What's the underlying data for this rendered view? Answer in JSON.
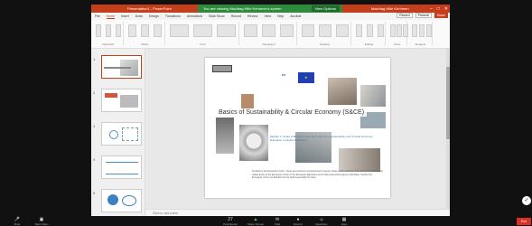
{
  "share_bar": {
    "text": "You are viewing Machtag Hille Kerhmen's screen",
    "options_label": "View Options"
  },
  "ppt": {
    "window_title": "Presentation1 - PowerPoint",
    "user": "Machtag Hille Kerhmen",
    "menu": [
      "File",
      "Home",
      "Insert",
      "Draw",
      "Design",
      "Transitions",
      "Animations",
      "Slide Show",
      "Record",
      "Review",
      "View",
      "Help",
      "Acrobat"
    ],
    "menu_right": {
      "record": "Record",
      "present": "Present",
      "share": "Share"
    },
    "ribbon_groups": [
      "Clipboard",
      "Slides",
      "Font",
      "Paragraph",
      "Drawing",
      "Editing",
      "Voice",
      "Designer"
    ],
    "notes_placeholder": "Click to add notes",
    "slide_numbers": [
      "1",
      "2",
      "3",
      "4",
      "5"
    ]
  },
  "slide": {
    "title": "Basics of Sustainability & Circular Economy (S&CE)",
    "subtitle": "Module 1: Smart & Blended Learning Content for Sustainability and Circular Economy Education in Higher Education",
    "description": "Funded by the European Union. Views and opinions expressed are however those of the author(s) only and do not necessarily reflect those of the European Union or the European Education and Culture Executive Agency (EACEA). Neither the European Union nor EACEA can be held responsible for them."
  },
  "zoom": {
    "mute": "Mute",
    "video": "Start Video",
    "participants": "Participants",
    "participants_count": "27",
    "share": "Share Screen",
    "chat": "Chat",
    "record": "Record",
    "reactions": "Reactions",
    "apps": "Apps",
    "end": "End"
  },
  "colors": {
    "accent": "#c43e1c",
    "share_green": "#2d8c3c",
    "eu_blue": "#1f3fb3",
    "end_red": "#d93025"
  }
}
